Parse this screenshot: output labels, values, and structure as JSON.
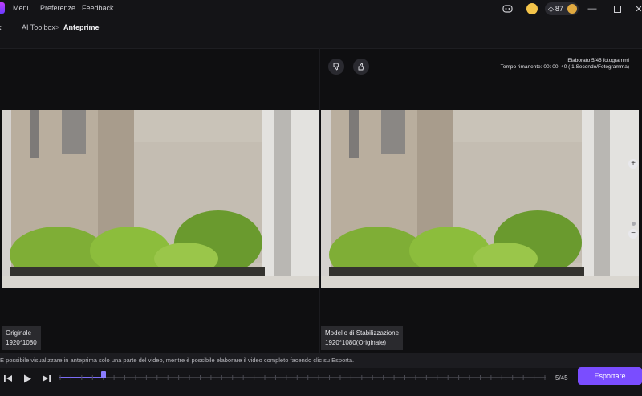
{
  "titlebar": {
    "menu": [
      "Menu",
      "Preferenze",
      "Feedback"
    ],
    "credits": "87"
  },
  "breadcrumb": {
    "parent": "AI Toolbox",
    "separator": ">",
    "current": "Anteprime"
  },
  "status": {
    "processed": "Elaborato 5/45 fotogrammi",
    "remaining": "Tempo rimanente: 00: 00: 40 ( 1 Secondo/Fotogramma)"
  },
  "left_panel": {
    "title": "Originale",
    "resolution": "1920*1080"
  },
  "right_panel": {
    "title": "Modello di Stabilizzazione",
    "resolution": "1920*1080(Originale)"
  },
  "info": {
    "text": "È possibile visualizzare in anteprima solo una parte del video, mentre è possibile elaborare il video completo facendo clic su Esporta."
  },
  "player": {
    "progress": 0.09,
    "counter": "5/45",
    "export_label": "Esportare"
  },
  "colors": {
    "accent": "#7a4dff",
    "track_fill": "#7b6cf6"
  },
  "icons": {
    "thumbs_down": "thumbs-down-icon",
    "thumbs_up": "thumbs-up-icon",
    "discord": "discord-icon",
    "back": "arrow-left-icon"
  }
}
